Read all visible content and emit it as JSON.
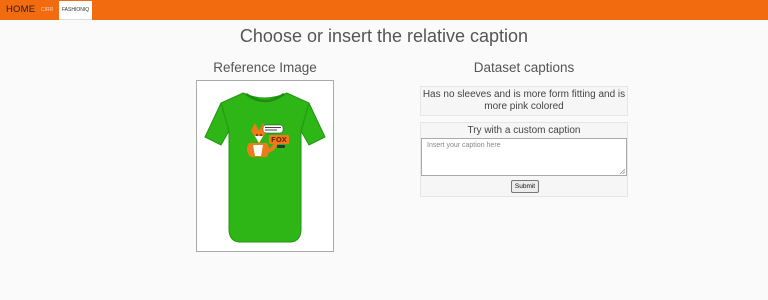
{
  "nav": {
    "home": "HOME",
    "items": [
      "CIRR",
      "FASHIONIQ"
    ],
    "active_index": 1
  },
  "page_title": "Choose or insert the relative caption",
  "reference": {
    "title": "Reference Image",
    "image_description_icon": "green-tshirt-fox-print"
  },
  "dataset": {
    "title": "Dataset captions",
    "caption": "Has no sleeves and is more form fitting and is more pink colored"
  },
  "custom": {
    "title": "Try with a custom caption",
    "placeholder": "Insert your caption here",
    "value": "",
    "submit_label": "Submit"
  },
  "colors": {
    "navbar": "#f26b0e",
    "shirt": "#2db616",
    "background": "#fafafa"
  }
}
